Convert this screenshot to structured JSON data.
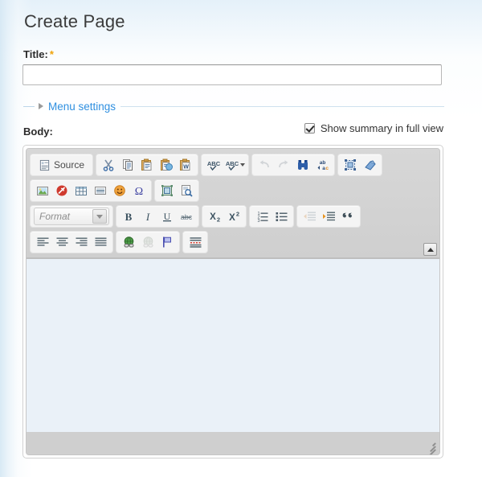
{
  "page": {
    "title": "Create Page"
  },
  "title_field": {
    "label": "Title:",
    "required_mark": "*",
    "value": "",
    "placeholder": ""
  },
  "menu_settings": {
    "label": "Menu settings",
    "expanded": false,
    "arrow_icon": "triangle-right-icon"
  },
  "body_field": {
    "label": "Body:"
  },
  "summary_toggle": {
    "label": "Show summary in full view",
    "checked": true
  },
  "editor": {
    "name": "CKEditor",
    "content": "",
    "content_background": "#eaf1f8",
    "chrome_background": "#cfcfcf",
    "toolbar_rows": [
      {
        "groups": [
          {
            "name": "document",
            "buttons": [
              {
                "name": "source-button",
                "label": "Source",
                "icon": "source-document-icon",
                "disabled": false
              }
            ]
          },
          {
            "name": "clipboard",
            "buttons": [
              {
                "name": "cut-button",
                "label": "Cut",
                "icon": "scissors-icon",
                "disabled": false
              },
              {
                "name": "copy-button",
                "label": "Copy",
                "icon": "copy-icon",
                "disabled": false
              },
              {
                "name": "paste-button",
                "label": "Paste",
                "icon": "paste-icon",
                "disabled": false
              },
              {
                "name": "paste-text-button",
                "label": "Paste as plain text",
                "icon": "paste-plain-text-icon",
                "disabled": false
              },
              {
                "name": "paste-word-button",
                "label": "Paste from Word",
                "icon": "paste-from-word-icon",
                "disabled": false
              }
            ]
          },
          {
            "name": "spellcheck",
            "buttons": [
              {
                "name": "spellcheck-button",
                "label": "Check Spelling",
                "icon": "abc-check-icon",
                "disabled": false
              },
              {
                "name": "scayt-button",
                "label": "Spell Check As You Type",
                "icon": "abc-check-dropdown-icon",
                "disabled": false,
                "has_dropdown": true
              }
            ]
          },
          {
            "name": "undo",
            "buttons": [
              {
                "name": "undo-button",
                "label": "Undo",
                "icon": "undo-arrow-icon",
                "disabled": true
              },
              {
                "name": "redo-button",
                "label": "Redo",
                "icon": "redo-arrow-icon",
                "disabled": true
              },
              {
                "name": "find-button",
                "label": "Find",
                "icon": "binoculars-icon",
                "disabled": false
              },
              {
                "name": "replace-button",
                "label": "Replace",
                "icon": "ab-replace-icon",
                "disabled": false
              }
            ]
          },
          {
            "name": "selection",
            "buttons": [
              {
                "name": "select-all-button",
                "label": "Select All",
                "icon": "select-all-icon",
                "disabled": false
              },
              {
                "name": "remove-format-button",
                "label": "Remove Format",
                "icon": "eraser-icon",
                "disabled": false
              }
            ]
          }
        ]
      },
      {
        "groups": [
          {
            "name": "insert",
            "buttons": [
              {
                "name": "image-button",
                "label": "Image",
                "icon": "image-icon",
                "disabled": false
              },
              {
                "name": "flash-button",
                "label": "Flash",
                "icon": "flash-icon",
                "disabled": false
              },
              {
                "name": "table-button",
                "label": "Table",
                "icon": "table-icon",
                "disabled": false
              },
              {
                "name": "horizontal-rule-button",
                "label": "Horizontal Line",
                "icon": "horizontal-rule-icon",
                "disabled": false
              },
              {
                "name": "smiley-button",
                "label": "Smiley",
                "icon": "smiley-icon",
                "disabled": false
              },
              {
                "name": "special-char-button",
                "label": "Insert Special Character",
                "icon": "omega-icon",
                "disabled": false
              }
            ]
          },
          {
            "name": "tools",
            "buttons": [
              {
                "name": "templates-button",
                "label": "Templates",
                "icon": "templates-icon",
                "disabled": false
              },
              {
                "name": "page-break-button",
                "label": "Page Break",
                "icon": "page-preview-icon",
                "disabled": false
              }
            ]
          }
        ]
      },
      {
        "groups": [
          {
            "name": "format-combo",
            "combo": {
              "name": "format-dropdown",
              "label": "Format",
              "icon": "chevron-down-icon"
            }
          },
          {
            "name": "basicstyles",
            "buttons": [
              {
                "name": "bold-button",
                "label": "B",
                "icon": "bold-icon",
                "disabled": false
              },
              {
                "name": "italic-button",
                "label": "I",
                "icon": "italic-icon",
                "disabled": false
              },
              {
                "name": "underline-button",
                "label": "U",
                "icon": "underline-icon",
                "disabled": false
              },
              {
                "name": "strikethrough-button",
                "label": "abc",
                "icon": "strikethrough-icon",
                "disabled": false
              }
            ]
          },
          {
            "name": "subsuper",
            "buttons": [
              {
                "name": "subscript-button",
                "label": "X2",
                "icon": "subscript-icon",
                "disabled": false
              },
              {
                "name": "superscript-button",
                "label": "X2",
                "icon": "superscript-icon",
                "disabled": false
              }
            ]
          },
          {
            "name": "lists",
            "buttons": [
              {
                "name": "numbered-list-button",
                "label": "Insert/Remove Numbered List",
                "icon": "numbered-list-icon",
                "disabled": false
              },
              {
                "name": "bulleted-list-button",
                "label": "Insert/Remove Bulleted List",
                "icon": "bulleted-list-icon",
                "disabled": false
              }
            ]
          },
          {
            "name": "indent",
            "buttons": [
              {
                "name": "outdent-button",
                "label": "Decrease Indent",
                "icon": "outdent-icon",
                "disabled": true
              },
              {
                "name": "indent-button",
                "label": "Increase Indent",
                "icon": "indent-icon",
                "disabled": false
              },
              {
                "name": "blockquote-button",
                "label": "Block Quote",
                "icon": "quote-icon",
                "disabled": false
              }
            ]
          }
        ]
      },
      {
        "groups": [
          {
            "name": "align",
            "buttons": [
              {
                "name": "align-left-button",
                "label": "Align Left",
                "icon": "align-left-icon",
                "disabled": false
              },
              {
                "name": "align-center-button",
                "label": "Center",
                "icon": "align-center-icon",
                "disabled": false
              },
              {
                "name": "align-right-button",
                "label": "Align Right",
                "icon": "align-right-icon",
                "disabled": false
              },
              {
                "name": "justify-button",
                "label": "Justify",
                "icon": "align-justify-icon",
                "disabled": false
              }
            ]
          },
          {
            "name": "links",
            "buttons": [
              {
                "name": "link-button",
                "label": "Link",
                "icon": "link-globe-icon",
                "disabled": false
              },
              {
                "name": "unlink-button",
                "label": "Unlink",
                "icon": "unlink-globe-icon",
                "disabled": true
              },
              {
                "name": "anchor-button",
                "label": "Anchor",
                "icon": "flag-anchor-icon",
                "disabled": false
              }
            ]
          },
          {
            "name": "blocks",
            "buttons": [
              {
                "name": "show-blocks-button",
                "label": "Show Blocks",
                "icon": "show-blocks-icon",
                "disabled": false
              }
            ]
          }
        ]
      }
    ],
    "collapse_toolbar_button": {
      "name": "collapse-toolbar-button",
      "label": "Collapse Toolbar",
      "icon": "triangle-up-icon"
    },
    "resize_handle": {
      "name": "editor-resize-handle",
      "icon": "resize-grip-icon"
    }
  },
  "colors": {
    "accent_link": "#2f8fe0",
    "required": "#f0a30a",
    "editor_bg": "#eaf1f8",
    "chrome": "#cfcfcf"
  }
}
